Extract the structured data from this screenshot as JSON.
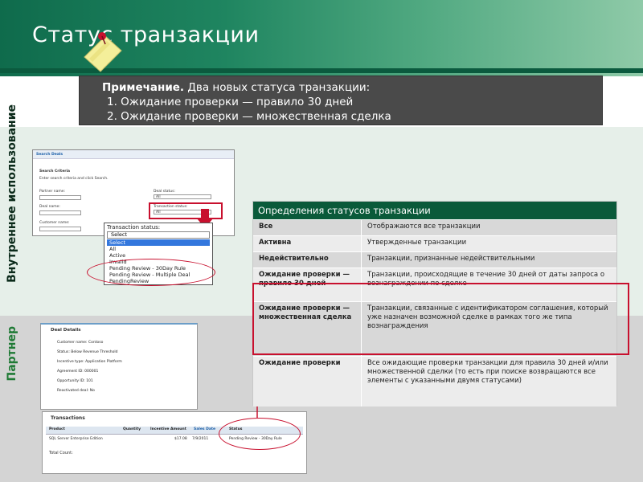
{
  "slide": {
    "title": "Статус транзакции",
    "side_label_inner": "Внутреннее использование",
    "side_label_partner": "Партнер"
  },
  "note": {
    "bold": "Примечание.",
    "text": " Два новых статуса транзакции:",
    "line1": "1. Ожидание проверки — правило 30 дней",
    "line2": "2. Ожидание проверки — множественная сделка"
  },
  "search_deals": {
    "title": "Search Deals",
    "criteria_title": "Search Criteria",
    "instructions": "Enter search criteria and click Search.",
    "partner_label": "Partner name:",
    "deal_status_label": "Deal status:",
    "deal_status_value": "All",
    "deal_name_label": "Deal name:",
    "transaction_status_label": "Transaction status:",
    "transaction_status_value": "All",
    "customer_label": "Customer name:"
  },
  "dropdown": {
    "label": "Transaction status:",
    "selected": "Select",
    "options": [
      "Select",
      "All",
      "Active",
      "Invalid",
      "Pending Review - 30Day Rule",
      "Pending Review - Multiple Deal",
      "PendingReview"
    ]
  },
  "deal_details": {
    "title": "Deal Details",
    "rows": [
      {
        "label": "Customer name:",
        "value": "Contoso"
      },
      {
        "label": "Status:",
        "value": "Below Revenue Threshold"
      },
      {
        "label": "Incentive type:",
        "value": "Application Platform"
      },
      {
        "label": "Agreement ID:",
        "value": "000001"
      },
      {
        "label": "Opportunity ID:",
        "value": "101"
      },
      {
        "label": "Reactivated deal:",
        "value": "No"
      }
    ]
  },
  "transactions": {
    "title": "Transactions",
    "columns": [
      "Product",
      "Quantity",
      "Incentive Amount",
      "Sales Date",
      "Status"
    ],
    "row": [
      "SQL Server Enterprise Edition",
      "",
      "$17.08",
      "7/9/2011",
      "Pending Review - 30Day Rule"
    ],
    "total_label": "Total Count:"
  },
  "definitions": {
    "title": "Определения статусов транзакции",
    "rows": [
      {
        "status": "Все",
        "description": "Отображаются все транзакции"
      },
      {
        "status": "Активна",
        "description": "Утвержденные транзакции"
      },
      {
        "status": "Недействительно",
        "description": "Транзакции, признанные недействительными"
      },
      {
        "status": "Ожидание проверки — правило 30 дней",
        "description": "Транзакции, происходящие в течение 30 дней от даты запроса о вознаграждении по сделке"
      },
      {
        "status": "Ожидание проверки — множественная сделка",
        "description": "Транзакции, связанные с идентификатором соглашения, который уже назначен возможной сделке в рамках того же типа вознаграждения"
      },
      {
        "status": "Ожидание проверки",
        "description": "Все ожидающие проверки транзакции для правила 30 дней и/или множественной сделки (то есть при поиске возвращаются все элементы с указанными двумя статусами)"
      }
    ]
  },
  "colors": {
    "header_dark": "#0f6b4c",
    "table_header": "#0a5a3a",
    "highlight_red": "#c8102e",
    "note_bg": "#4a4a4a"
  }
}
